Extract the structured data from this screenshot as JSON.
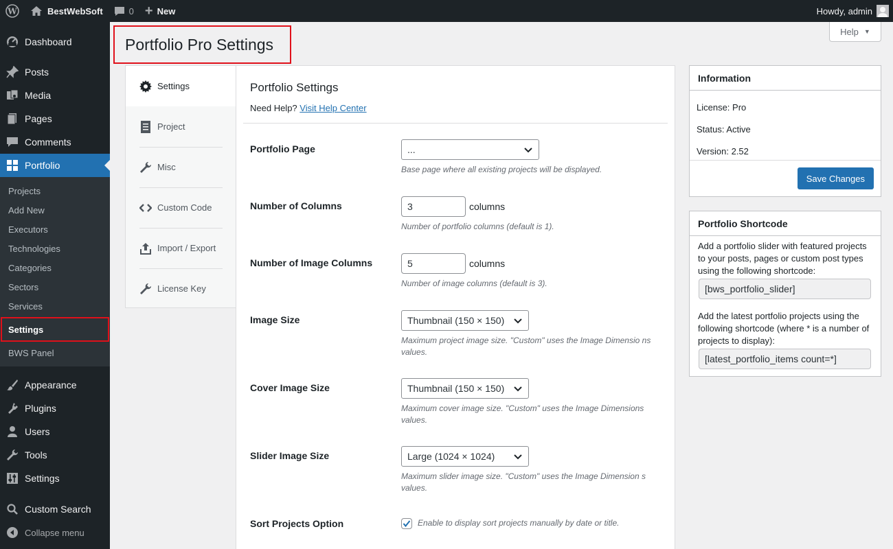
{
  "adminbar": {
    "site_name": "BestWebSoft",
    "comments_count": "0",
    "new_label": "New",
    "howdy": "Howdy, admin"
  },
  "sidebar": {
    "top_items": [
      {
        "label": "Dashboard",
        "icon": "dashboard-icon"
      },
      {
        "label": "Posts",
        "icon": "pin-icon"
      },
      {
        "label": "Media",
        "icon": "media-icon"
      },
      {
        "label": "Pages",
        "icon": "pages-icon"
      },
      {
        "label": "Comments",
        "icon": "comment-icon"
      },
      {
        "label": "Portfolio",
        "icon": "grid-icon"
      }
    ],
    "portfolio_sub": [
      "Projects",
      "Add New",
      "Executors",
      "Technologies",
      "Categories",
      "Sectors",
      "Services",
      "Settings",
      "BWS Panel"
    ],
    "bottom_items": [
      {
        "label": "Appearance",
        "icon": "brush-icon"
      },
      {
        "label": "Plugins",
        "icon": "plug-icon"
      },
      {
        "label": "Users",
        "icon": "user-icon"
      },
      {
        "label": "Tools",
        "icon": "wrench-icon"
      },
      {
        "label": "Settings",
        "icon": "sliders-icon"
      },
      {
        "label": "Custom Search",
        "icon": "search-icon"
      },
      {
        "label": "Collapse menu",
        "icon": "collapse-icon"
      }
    ]
  },
  "page": {
    "title": "Portfolio Pro Settings",
    "help": "Help"
  },
  "tabs": [
    "Settings",
    "Project",
    "Misc",
    "Custom Code",
    "Import / Export",
    "License Key"
  ],
  "panel": {
    "heading": "Portfolio Settings",
    "need_help": "Need Help?",
    "help_link": "Visit Help Center",
    "fields": {
      "portfolio_page": {
        "label": "Portfolio Page",
        "value": "...",
        "desc": "Base page where all existing projects will be displayed."
      },
      "columns": {
        "label": "Number of Columns",
        "value": "3",
        "unit": "columns",
        "desc": "Number of portfolio columns (default is 1)."
      },
      "image_columns": {
        "label": "Number of Image Columns",
        "value": "5",
        "unit": "columns",
        "desc": "Number of image columns (default is 3)."
      },
      "image_size": {
        "label": "Image Size",
        "value": "Thumbnail (150 × 150)",
        "desc": "Maximum project image size. \"Custom\" uses the Image Dimensio ns values."
      },
      "cover_size": {
        "label": "Cover Image Size",
        "value": "Thumbnail (150 × 150)",
        "desc": "Maximum cover image size. \"Custom\" uses the Image Dimensions values."
      },
      "slider_size": {
        "label": "Slider Image Size",
        "value": "Large (1024 × 1024)",
        "desc": "Maximum slider image size. \"Custom\" uses the Image Dimension s values."
      },
      "sort": {
        "label": "Sort Projects Option",
        "checked": true,
        "desc": "Enable to display sort projects manually by date or title."
      }
    }
  },
  "info": {
    "heading": "Information",
    "license": "License: Pro",
    "status": "Status: Active",
    "version": "Version: 2.52",
    "save": "Save Changes"
  },
  "shortcode": {
    "heading": "Portfolio Shortcode",
    "text1": "Add a portfolio slider with featured projects to your posts, pages or custom post types using the following shortcode:",
    "code1": "[bws_portfolio_slider]",
    "text2": "Add the latest portfolio projects using the following shortcode (where * is a number of projects to display):",
    "code2": "[latest_portfolio_items count=*]"
  },
  "colors": {
    "accent": "#2271b1",
    "highlight": "#e0101a",
    "sidebar": "#1d2327"
  }
}
